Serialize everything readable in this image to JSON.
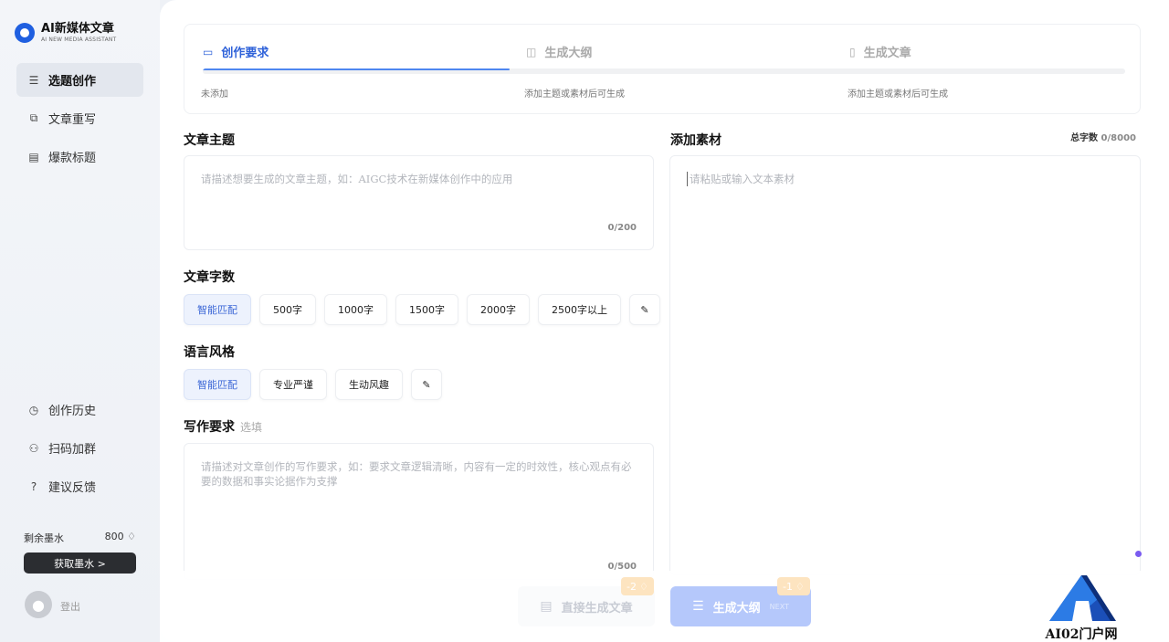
{
  "app": {
    "title": "AI新媒体文章",
    "subtitle": "AI NEW MEDIA ASSISTANT",
    "accent": "#1f5fe0"
  },
  "sidebar": {
    "top_items": [
      {
        "label": "选题创作",
        "icon": "list-icon",
        "active": true
      },
      {
        "label": "文章重写",
        "icon": "rewrite-icon",
        "active": false
      },
      {
        "label": "爆款标题",
        "icon": "document-icon",
        "active": false
      }
    ],
    "bottom_items": [
      {
        "label": "创作历史",
        "icon": "clock-icon"
      },
      {
        "label": "扫码加群",
        "icon": "group-icon"
      },
      {
        "label": "建议反馈",
        "icon": "question-icon"
      }
    ],
    "quota_label": "剩余墨水",
    "quota_value": "800",
    "get_ink_label": "获取墨水 >",
    "logout_label": "登出"
  },
  "steps": {
    "items": [
      {
        "label": "创作要求",
        "note": "未添加",
        "active": true
      },
      {
        "label": "生成大纲",
        "note": "添加主题或素材后可生成",
        "active": false
      },
      {
        "label": "生成文章",
        "note": "添加主题或素材后可生成",
        "active": false
      }
    ],
    "progress_fraction": 0.333
  },
  "topic": {
    "title": "文章主题",
    "placeholder": "请描述想要生成的文章主题，如：AIGC技术在新媒体创作中的应用",
    "count": "0/200"
  },
  "word_count": {
    "title": "文章字数",
    "options": [
      "智能匹配",
      "500字",
      "1000字",
      "1500字",
      "2000字",
      "2500字以上"
    ],
    "selected": "智能匹配"
  },
  "style": {
    "title": "语言风格",
    "options": [
      "智能匹配",
      "专业严谨",
      "生动风趣"
    ],
    "selected": "智能匹配"
  },
  "requirements": {
    "title": "写作要求",
    "optional_label": "选填",
    "placeholder": "请描述对文章创作的写作要求，如：要求文章逻辑清晰，内容有一定的时效性，核心观点有必要的数据和事实论据作为支撑",
    "count": "0/500"
  },
  "material": {
    "title": "添加素材",
    "total_label": "总字数",
    "total_value": "0/8000",
    "placeholder": "请粘贴或输入文本素材"
  },
  "actions": {
    "direct_label": "直接生成文章",
    "direct_cost": "-2",
    "outline_label": "生成大纲",
    "outline_next": "NEXT",
    "outline_cost": "-1"
  },
  "watermark": {
    "text": "AI02门户网"
  }
}
